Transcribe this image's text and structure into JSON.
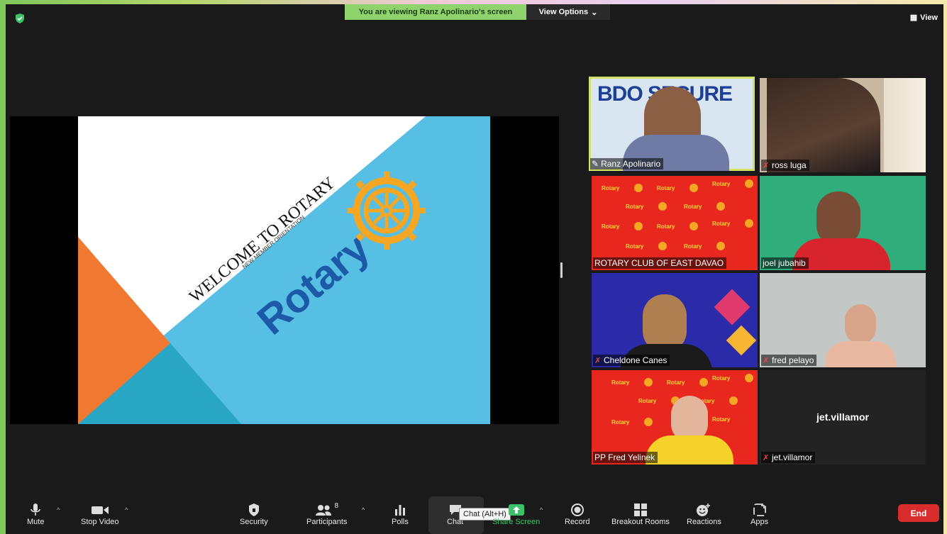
{
  "banner": {
    "viewing_text": "You are viewing Ranz Apolinario's screen",
    "view_options_label": "View Options",
    "view_label": "View"
  },
  "slide": {
    "title": "WELCOME TO ROTARY",
    "subtitle": "NEW MEMBER ORIENTATION",
    "wordmark": "Rotary",
    "colors": {
      "blue": "#56bfe3",
      "orange": "#f07831",
      "teal": "#2aa6c5",
      "gold": "#f5a623",
      "navy": "#1c5aa8"
    }
  },
  "participants": [
    {
      "name": "Ranz Apolinario",
      "muted": false,
      "active": true,
      "bg_text": "BDO SECURE"
    },
    {
      "name": "ross luga",
      "muted": true
    },
    {
      "name": "ROTARY CLUB OF EAST DAVAO",
      "muted": false
    },
    {
      "name": "joel jubahib",
      "muted": false
    },
    {
      "name": "Cheldone Canes",
      "muted": true
    },
    {
      "name": "fred pelayo",
      "muted": true
    },
    {
      "name": "PP Fred Yelinek",
      "muted": false
    },
    {
      "name": "jet.villamor",
      "muted": true,
      "display_name": "jet.villamor"
    }
  ],
  "toolbar": {
    "mute": "Mute",
    "stop_video": "Stop Video",
    "security": "Security",
    "participants": "Participants",
    "participants_count": "8",
    "polls": "Polls",
    "chat": "Chat",
    "chat_tooltip": "Chat (Alt+H)",
    "share_screen": "Share Screen",
    "record": "Record",
    "breakout_rooms": "Breakout Rooms",
    "reactions": "Reactions",
    "apps": "Apps",
    "end": "End"
  },
  "colors": {
    "share_green": "#3cc36a",
    "end_red": "#d92d2d",
    "banner_green": "#8fd36c"
  }
}
